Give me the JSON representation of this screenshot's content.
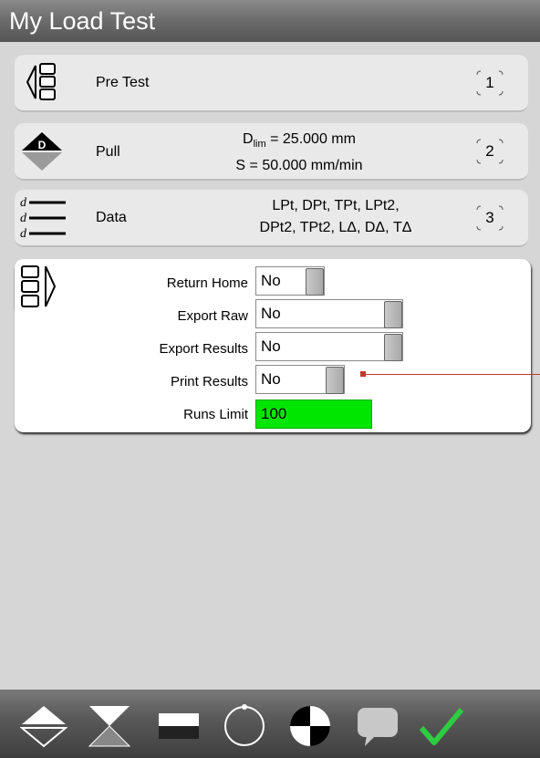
{
  "window": {
    "title": "My Load Test"
  },
  "cards": [
    {
      "id": "pre-test",
      "label": "Pre Test",
      "detail_lines": [],
      "step": "1"
    },
    {
      "id": "pull",
      "label": "Pull",
      "detail_html": {
        "d_main": "D",
        "d_sub": "lim",
        "d_value": " = 25.000 mm",
        "s_line": "S = 50.000 mm/min"
      },
      "step": "2"
    },
    {
      "id": "data",
      "label": "Data",
      "detail_lines": [
        "LPt, DPt, TPt, LPt2,",
        "DPt2, TPt2, LΔ, DΔ, TΔ"
      ],
      "step": "3"
    }
  ],
  "icons": {
    "data_prefix": "d"
  },
  "settings": [
    {
      "label": "Return Home",
      "value": "No"
    },
    {
      "label": "Export Raw",
      "value": "No"
    },
    {
      "label": "Export Results",
      "value": "No"
    },
    {
      "label": "Print Results",
      "value": "No"
    },
    {
      "label": "Runs Limit",
      "value": "100"
    }
  ],
  "colors": {
    "accent_green": "#00e600",
    "check_green": "#2ecc40",
    "leader_red": "#c0392b"
  },
  "toolbar": {
    "icons": [
      "move-up-down-icon",
      "hourglass-icon",
      "split-rectangle-icon",
      "rotate-icon",
      "quarter-circle-icon",
      "speech-bubble-icon",
      "checkmark-icon"
    ]
  }
}
